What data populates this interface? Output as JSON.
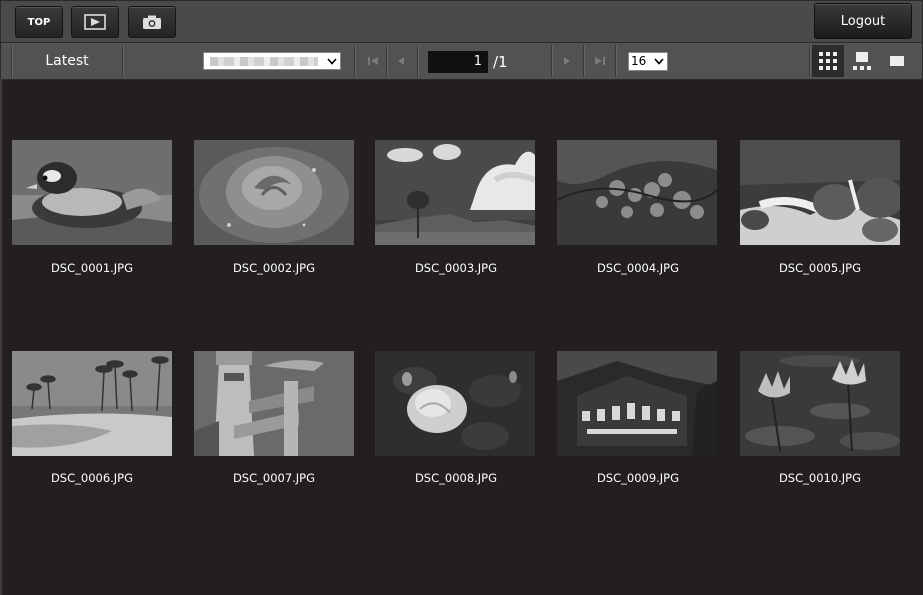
{
  "toolbar": {
    "top_label": "TOP",
    "play_icon": "playback-icon",
    "camera_icon": "camera-icon",
    "logout_label": "Logout"
  },
  "nav": {
    "latest_label": "Latest",
    "folder_select_value": "",
    "page_current": "1",
    "page_total": "/1",
    "per_page": "16",
    "views": [
      "grid-view-icon",
      "filmstrip-view-icon",
      "single-view-icon"
    ]
  },
  "photos": [
    {
      "name": "DSC_0001.JPG"
    },
    {
      "name": "DSC_0002.JPG"
    },
    {
      "name": "DSC_0003.JPG"
    },
    {
      "name": "DSC_0004.JPG"
    },
    {
      "name": "DSC_0005.JPG"
    },
    {
      "name": "DSC_0006.JPG"
    },
    {
      "name": "DSC_0007.JPG"
    },
    {
      "name": "DSC_0008.JPG"
    },
    {
      "name": "DSC_0009.JPG"
    },
    {
      "name": "DSC_0010.JPG"
    }
  ]
}
